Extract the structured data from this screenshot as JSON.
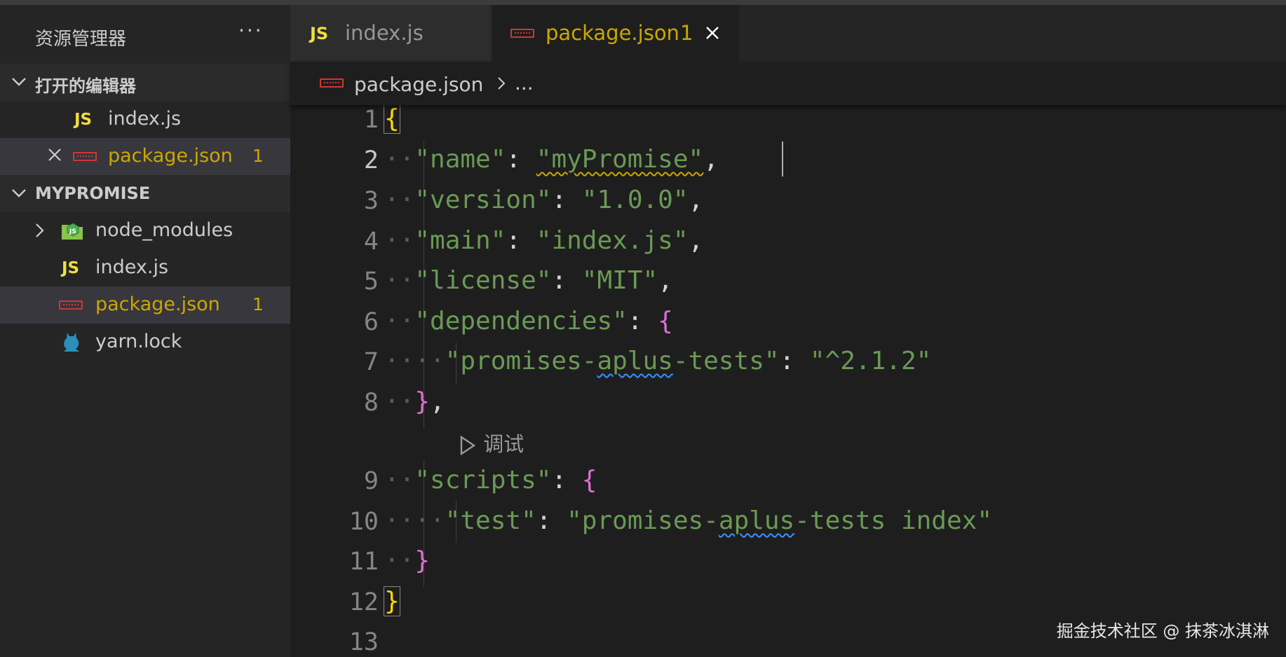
{
  "sidebar": {
    "title": "资源管理器",
    "more": "···",
    "open_editors": {
      "label": "打开的编辑器",
      "items": [
        {
          "icon": "js-icon",
          "label": "index.js"
        },
        {
          "icon": "npm-icon",
          "label": "package.json",
          "badge": "1"
        }
      ]
    },
    "folder": {
      "label": "MYPROMISE",
      "items": [
        {
          "icon": "node-folder-icon",
          "label": "node_modules"
        },
        {
          "icon": "js-icon",
          "label": "index.js"
        },
        {
          "icon": "npm-icon",
          "label": "package.json",
          "badge": "1"
        },
        {
          "icon": "yarn-icon",
          "label": "yarn.lock"
        }
      ]
    },
    "js_icon_text": "JS"
  },
  "tabs": [
    {
      "label": "index.js",
      "icon": "js-icon",
      "active": false
    },
    {
      "label": "package.json",
      "icon": "npm-icon",
      "badge": "1",
      "active": true
    }
  ],
  "breadcrumb": {
    "file": "package.json",
    "more": "..."
  },
  "gutter": [
    "1",
    "2",
    "3",
    "4",
    "5",
    "6",
    "7",
    "8",
    "9",
    "10",
    "11",
    "12",
    "13"
  ],
  "codelens": {
    "label": "调试"
  },
  "watermark": "掘金技术社区 @ 抹茶冰淇淋",
  "colors": {
    "key": "#9cdcfe",
    "string": "#6a9955",
    "bracket_level1": "#ffd700",
    "bracket_level2": "#da70d6",
    "modified": "#cca700"
  }
}
